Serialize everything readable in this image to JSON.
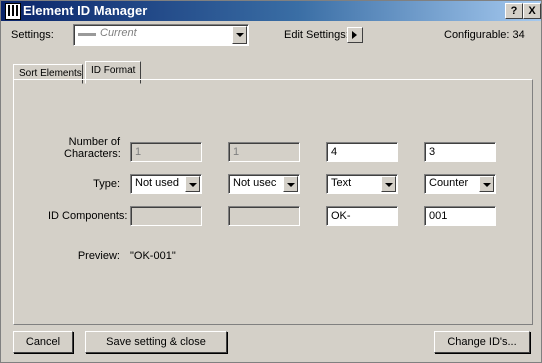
{
  "window": {
    "title": "Element ID Manager",
    "help_btn": "?",
    "close_btn": "X"
  },
  "settings": {
    "label": "Settings:",
    "value": "Current",
    "edit_label": "Edit Settings:",
    "configurable": "Configurable: 34"
  },
  "tabs": [
    {
      "label": "Sort Elements"
    },
    {
      "label": "ID Format"
    }
  ],
  "form": {
    "num_chars_label": "Number of Characters:",
    "num_chars": [
      "1",
      "1",
      "4",
      "3"
    ],
    "type_label": "Type:",
    "types": [
      "Not used",
      "Not usec",
      "Text",
      "Counter"
    ],
    "components_label": "ID Components:",
    "components": [
      "",
      "",
      "OK-",
      "001"
    ],
    "preview_label": "Preview:",
    "preview_value": "\"OK-001\""
  },
  "buttons": {
    "cancel": "Cancel",
    "save_close": "Save setting & close",
    "change_ids": "Change ID's..."
  }
}
